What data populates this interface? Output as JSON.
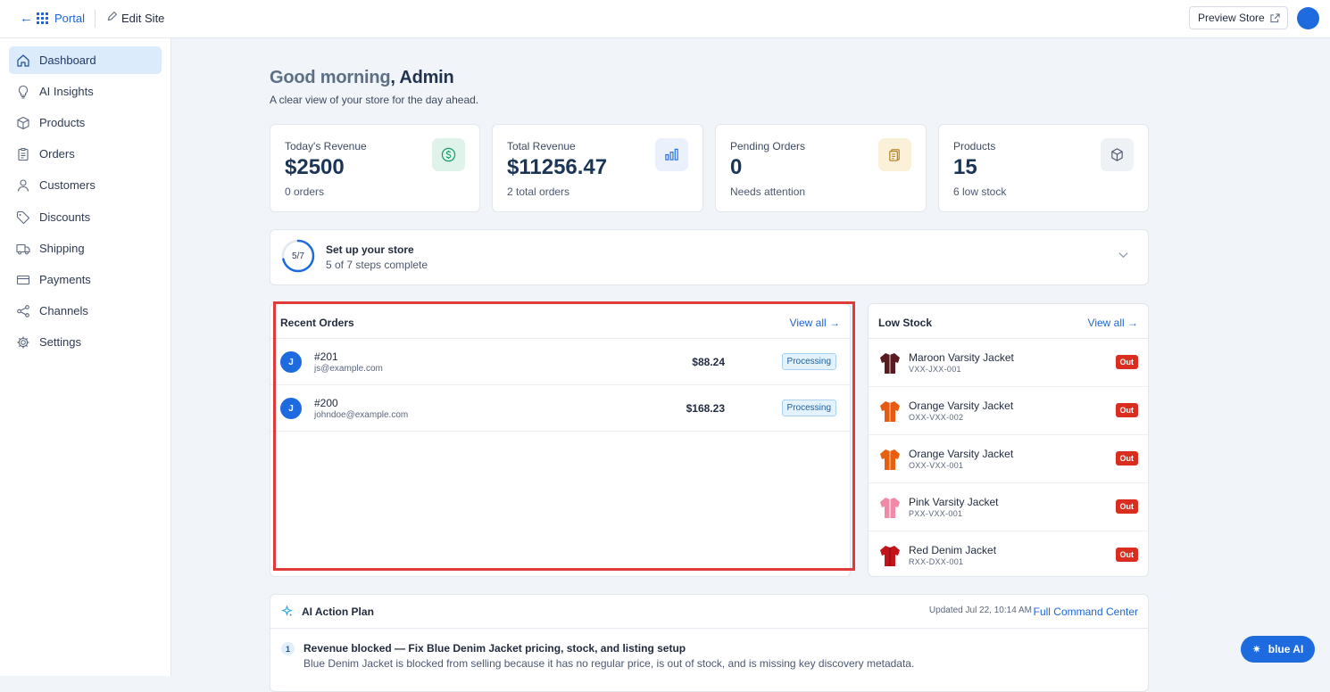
{
  "topbar": {
    "back_icon": "arrow-left-icon",
    "portal_label": "Portal",
    "edit_label": "Edit Site",
    "preview_label": "Preview Store",
    "accent": "#1e6be0"
  },
  "sidebar": {
    "items": [
      {
        "label": "Dashboard",
        "icon": "home-icon",
        "active": true
      },
      {
        "label": "AI Insights",
        "icon": "lightbulb-icon"
      },
      {
        "label": "Products",
        "icon": "box-icon"
      },
      {
        "label": "Orders",
        "icon": "clipboard-icon"
      },
      {
        "label": "Customers",
        "icon": "user-icon"
      },
      {
        "label": "Discounts",
        "icon": "tag-icon"
      },
      {
        "label": "Shipping",
        "icon": "truck-icon"
      },
      {
        "label": "Payments",
        "icon": "credit-card-icon"
      },
      {
        "label": "Channels",
        "icon": "share-icon"
      },
      {
        "label": "Settings",
        "icon": "gear-icon"
      }
    ]
  },
  "header": {
    "greeting": "Good morning",
    "name": ", Admin",
    "subtitle": "A clear view of your store for the day ahead."
  },
  "stats": [
    {
      "label": "Today's Revenue",
      "value": "$2500",
      "meta": "0 orders",
      "icon": "dollar-icon",
      "color": "#1a9a6a"
    },
    {
      "label": "Total Revenue",
      "value": "$11256.47",
      "meta": "2 total orders",
      "icon": "bar-chart-icon",
      "color": "#1e6be0"
    },
    {
      "label": "Pending Orders",
      "value": "0",
      "meta": "Needs attention",
      "icon": "clipboard-icon",
      "color": "#b07a16"
    },
    {
      "label": "Products",
      "value": "15",
      "meta": "6 low stock",
      "icon": "cube-icon",
      "color": "#4b5870"
    }
  ],
  "setup": {
    "ring_text": "5/7",
    "title": "Set up your store",
    "subtitle": "5 of 7 steps complete",
    "progress": 0.714
  },
  "recent_orders": {
    "title": "Recent Orders",
    "view_all": "View all →",
    "rows": [
      {
        "avatar": "J",
        "id": "#201",
        "email": "js@example.com",
        "amount": "$88.24",
        "status": "Processing"
      },
      {
        "avatar": "J",
        "id": "#200",
        "email": "johndoe@example.com",
        "amount": "$168.23",
        "status": "Processing"
      }
    ]
  },
  "low_stock": {
    "title": "Low Stock",
    "view_all": "View all →",
    "rows": [
      {
        "name": "Maroon Varsity Jacket",
        "sku": "VXX-JXX-001",
        "badge": "Out",
        "color": "#5a1a22"
      },
      {
        "name": "Orange Varsity Jacket",
        "sku": "OXX-VXX-002",
        "badge": "Out",
        "color": "#e85a12"
      },
      {
        "name": "Orange Varsity Jacket",
        "sku": "OXX-VXX-001",
        "badge": "Out",
        "color": "#e6600f"
      },
      {
        "name": "Pink Varsity Jacket",
        "sku": "PXX-VXX-001",
        "badge": "Out",
        "color": "#f08aa8"
      },
      {
        "name": "Red Denim Jacket",
        "sku": "RXX-DXX-001",
        "badge": "Out",
        "color": "#c3141c"
      }
    ]
  },
  "action_plan": {
    "title": "AI Action Plan",
    "updated": "Updated Jul 22, 10:14 AM",
    "link": "Full Command Center",
    "item_number": "1",
    "item_title": "Revenue blocked — Fix Blue Denim Jacket pricing, stock, and listing setup",
    "item_desc": "Blue Denim Jacket is blocked from selling because it has no regular price, is out of stock, and is missing key discovery metadata."
  },
  "fab": {
    "label": "blue AI",
    "icon": "sparkle-icon"
  }
}
